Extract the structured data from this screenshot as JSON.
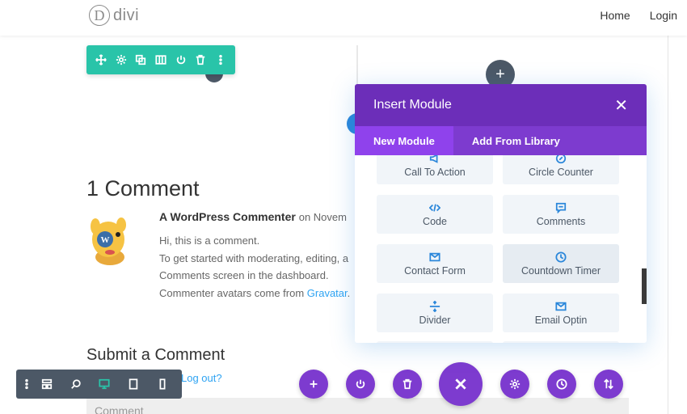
{
  "header": {
    "logo_mark": "D",
    "logo_text": "divi",
    "nav": [
      "Home",
      "Login"
    ]
  },
  "canvas": {
    "add_symbol": "+"
  },
  "comments": {
    "title": "1 Comment",
    "author": "A WordPress Commenter",
    "on_text": "on Novem",
    "lines": [
      "Hi, this is a comment.",
      "To get started with moderating, editing, a",
      "Comments screen in the dashboard."
    ],
    "last_line_prefix": "Commenter avatars come from ",
    "last_line_link": "Gravatar",
    "last_line_suffix": "."
  },
  "submit": {
    "title": "Submit a Comment",
    "logout": "Log out?",
    "placeholder": "Comment"
  },
  "modal": {
    "title": "Insert Module",
    "close_symbol": "✕",
    "tabs": [
      "New Module",
      "Add From Library"
    ],
    "modules": [
      {
        "label": "Call To Action",
        "icon": "megaphone-icon"
      },
      {
        "label": "Circle Counter",
        "icon": "circle-counter-icon"
      },
      {
        "label": "Code",
        "icon": "code-icon"
      },
      {
        "label": "Comments",
        "icon": "comments-icon"
      },
      {
        "label": "Contact Form",
        "icon": "envelope-icon"
      },
      {
        "label": "Countdown Timer",
        "icon": "clock-icon"
      },
      {
        "label": "Divider",
        "icon": "divider-icon"
      },
      {
        "label": "Email Optin",
        "icon": "envelope-icon"
      }
    ]
  },
  "colors": {
    "teal": "#29c4a9",
    "purple": "#7d3bcf",
    "purple_dark": "#6c2eb9",
    "blue": "#2b87da",
    "slate": "#4c5866"
  }
}
